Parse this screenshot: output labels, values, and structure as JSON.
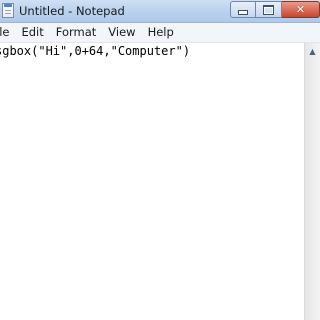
{
  "window": {
    "title": "Untitled - Notepad",
    "icons": {
      "app": "notepad-icon",
      "minimize": "minimize-icon",
      "maximize": "maximize-icon",
      "close": "close-icon",
      "scroll_up": "scroll-up-arrow-icon"
    },
    "close_glyph": "✕",
    "scroll_up_glyph": "▲"
  },
  "menu": {
    "items": [
      {
        "label": "ile"
      },
      {
        "label": "Edit"
      },
      {
        "label": "Format"
      },
      {
        "label": "View"
      },
      {
        "label": "Help"
      }
    ]
  },
  "editor": {
    "content": "sgbox(\"Hi\",0+64,\"Computer\")"
  },
  "colors": {
    "titlebar": "#bcd3ee",
    "close_button": "#c8452f",
    "menubar": "#f2f5fa"
  }
}
